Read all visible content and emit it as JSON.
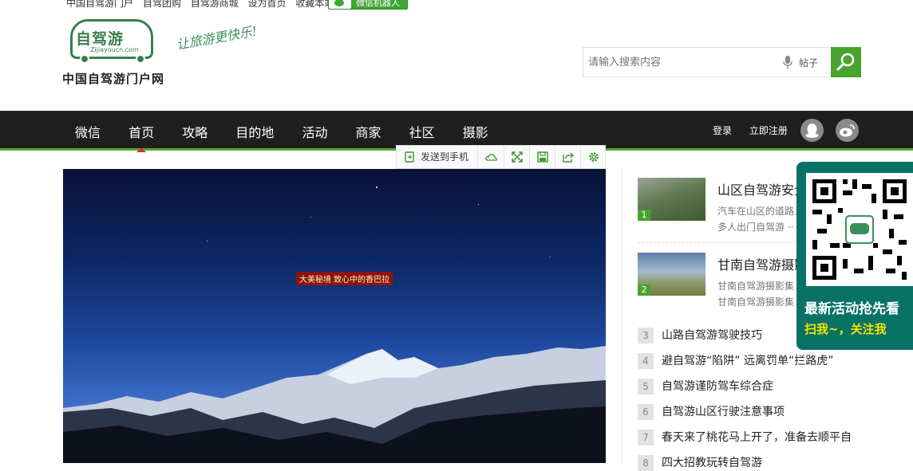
{
  "topbar": {
    "links": [
      "中国自驾游门户",
      "自驾团购",
      "自驾游商城",
      "设为首页",
      "收藏本站"
    ],
    "wechat_robot": "微信机器人"
  },
  "logo": {
    "brand": "自驾游",
    "url": "Zijiayoucn.com",
    "name": "中国自驾游门户网",
    "slogan": "让旅游更快乐!"
  },
  "search": {
    "placeholder": "请输入搜索内容",
    "type": "帖子"
  },
  "nav": {
    "items": [
      "微信",
      "首页",
      "攻略",
      "目的地",
      "活动",
      "商家",
      "社区",
      "摄影"
    ],
    "active": "首页",
    "login": "登录",
    "register": "立即注册"
  },
  "toolbar": {
    "send_label": "发送到手机"
  },
  "slide": {
    "caption": "大美秘境 致心中的香巴拉"
  },
  "features": [
    {
      "num": "1",
      "title": "山区自驾游安全",
      "desc1": "汽车在山区的道路上",
      "desc2": "多人出门自驾游 ··"
    },
    {
      "num": "2",
      "title": "甘南自驾游摄影",
      "desc1": "甘南自驾游摄影集",
      "desc2": "甘南自驾游摄影集"
    }
  ],
  "ranked": [
    {
      "num": "3",
      "title": "山路自驾游驾驶技巧"
    },
    {
      "num": "4",
      "title": "避自驾游“陷阱” 远离罚单“拦路虎”"
    },
    {
      "num": "5",
      "title": "自驾游谨防驾车综合症"
    },
    {
      "num": "6",
      "title": "自驾游山区行驶注意事项"
    },
    {
      "num": "7",
      "title": "春天来了桃花马上开了，准备去顺平自"
    },
    {
      "num": "8",
      "title": "四大招教玩转自驾游"
    }
  ],
  "qr": {
    "line1": "最新活动抢先看",
    "line2": "扫我~，关注我"
  }
}
